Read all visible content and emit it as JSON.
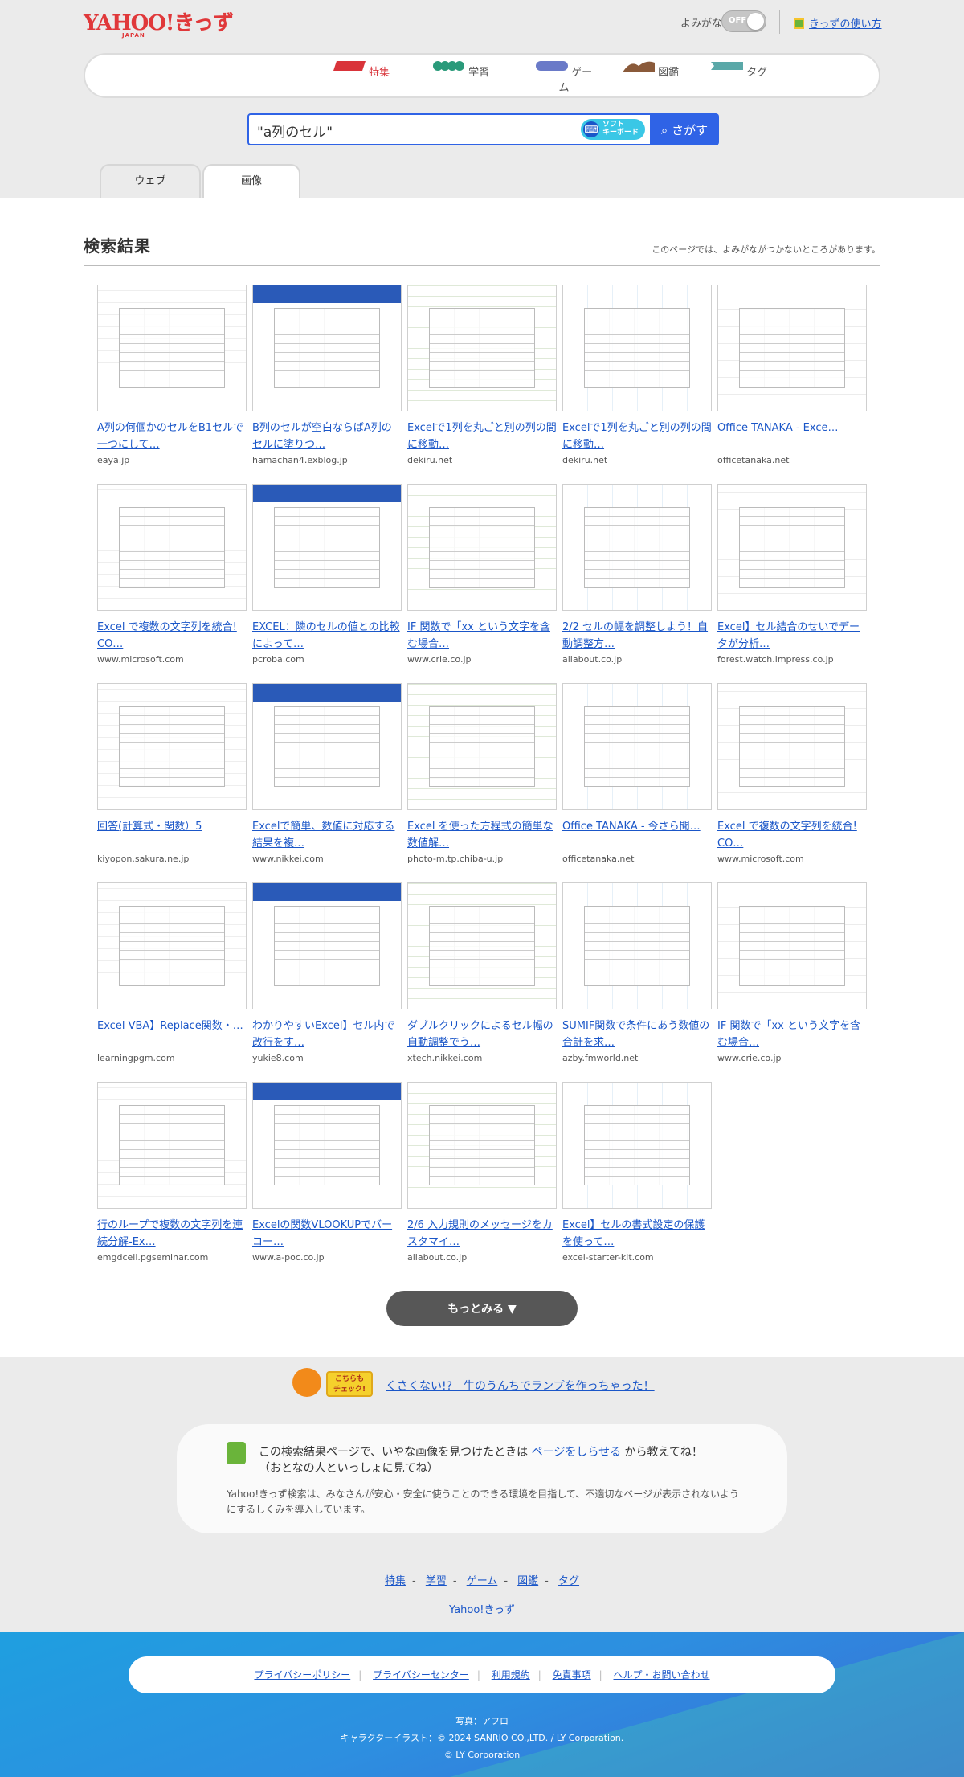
{
  "header": {
    "logo_main": "YAHOO!きっず",
    "logo_sub": "JAPAN",
    "yomigana_label": "よみがな",
    "toggle_state": "OFF",
    "guide_link": "きっずの使い方"
  },
  "nav": {
    "items": [
      {
        "label": "特集",
        "color": "#d9343a"
      },
      {
        "label": "学習",
        "color": "#2a9a7a"
      },
      {
        "label": "ゲーム",
        "color": "#6a7ac8"
      },
      {
        "label": "図鑑",
        "color": "#8a5a3a"
      },
      {
        "label": "タグ",
        "color": "#5aa8a8"
      }
    ]
  },
  "search": {
    "query": "\"a列のセル\"",
    "keyboard_label_1": "ソフト",
    "keyboard_label_2": "キーボード",
    "button_label": "さがす"
  },
  "tabs": [
    {
      "label": "ウェブ",
      "active": false
    },
    {
      "label": "画像",
      "active": true
    }
  ],
  "results": {
    "title": "検索結果",
    "note": "このページでは、よみがながつかないところがあります。",
    "items": [
      {
        "title": "A列の何個かのセルをB1セルで一つにして…",
        "host": "eaya.jp"
      },
      {
        "title": "B列のセルが空白ならばA列のセルに塗りつ…",
        "host": "hamachan4.exblog.jp"
      },
      {
        "title": "Excelで1列を丸ごと別の列の間に移動…",
        "host": "dekiru.net"
      },
      {
        "title": "Excelで1列を丸ごと別の列の間に移動…",
        "host": "dekiru.net"
      },
      {
        "title": "Office TANAKA - Exce…",
        "host": "officetanaka.net"
      },
      {
        "title": "Excel で複数の文字列を統合! CO…",
        "host": "www.microsoft.com"
      },
      {
        "title": "EXCEL：隣のセルの値との比較によって…",
        "host": "pcroba.com"
      },
      {
        "title": "IF 関数で「xx という文字を含む場合…",
        "host": "www.crie.co.jp"
      },
      {
        "title": "2/2 セルの幅を調整しよう！自動調整方…",
        "host": "allabout.co.jp"
      },
      {
        "title": "Excel】セル結合のせいでデータが分析…",
        "host": "forest.watch.impress.co.jp"
      },
      {
        "title": "回答(計算式・関数）5",
        "host": "kiyopon.sakura.ne.jp"
      },
      {
        "title": "Excelで簡単、数値に対応する結果を複…",
        "host": "www.nikkei.com"
      },
      {
        "title": "Excel を使った方程式の簡単な数値解…",
        "host": "photo-m.tp.chiba-u.jp"
      },
      {
        "title": "Office TANAKA - 今さら聞…",
        "host": "officetanaka.net"
      },
      {
        "title": "Excel で複数の文字列を統合! CO…",
        "host": "www.microsoft.com"
      },
      {
        "title": "Excel VBA】Replace関数・…",
        "host": "learningpgm.com"
      },
      {
        "title": "わかりやすいExcel】セル内で改行をす…",
        "host": "yukie8.com"
      },
      {
        "title": "ダブルクリックによるセル幅の自動調整でう…",
        "host": "xtech.nikkei.com"
      },
      {
        "title": "SUMIF関数で条件にあう数値の合計を求…",
        "host": "azby.fmworld.net"
      },
      {
        "title": "IF 関数で「xx という文字を含む場合…",
        "host": "www.crie.co.jp"
      },
      {
        "title": "行のループで複数の文字列を連続分解-Ex…",
        "host": "emgdcell.pgseminar.com"
      },
      {
        "title": "Excelの関数VLOOKUPでバーコー…",
        "host": "www.a-poc.co.jp"
      },
      {
        "title": "2/6 入力規則のメッセージをカスタマイ…",
        "host": "allabout.co.jp"
      },
      {
        "title": "Excel】セルの書式設定の保護を使って…",
        "host": "excel-starter-kit.com"
      }
    ],
    "more_label": "もっとみる ▼"
  },
  "bottom": {
    "promo_badge_1": "こちらも",
    "promo_badge_2": "チェック!",
    "promo_link": "くさくない!?　牛のうんちでランプを作っちゃった！",
    "report_line1_pre": "この検索結果ページで、いやな画像を見つけたときは",
    "report_link": "ページをしらせる",
    "report_line1_post": "から教えてね！",
    "report_line2": "（おとなの人といっしょに見てね）",
    "report_text": "Yahoo!きっず検索は、みなさんが安心・安全に使うことのできる環境を目指して、不適切なページが表示されないようにするしくみを導入しています。",
    "footer_links": [
      "特集",
      "学習",
      "ゲーム",
      "図鑑",
      "タグ"
    ],
    "home_link": "Yahoo!きっず"
  },
  "footer": {
    "links": [
      "プライバシーポリシー",
      "プライバシーセンター",
      "利用規約",
      "免責事項",
      "ヘルプ・お問い合わせ"
    ],
    "credit_photo": "写真：アフロ",
    "credit_illust": "キャラクターイラスト：© 2024 SANRIO CO.,LTD. / LY Corporation.",
    "credit_copy": "© LY Corporation"
  }
}
